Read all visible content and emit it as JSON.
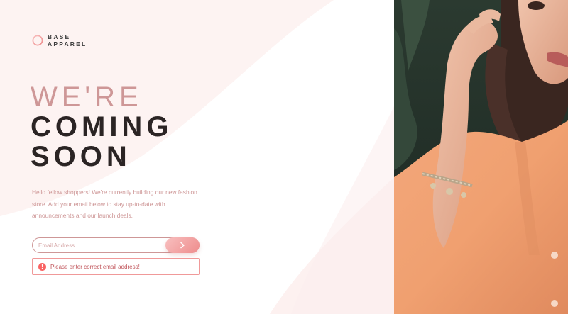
{
  "brand": {
    "line1": "BASE",
    "line2": "APPAREL",
    "icon": "ring-logo-icon"
  },
  "hero": {
    "headline_light": "WE'RE",
    "headline_dark_1": "COMING",
    "headline_dark_2": "SOON",
    "description": "Hello fellow shoppers! We're currently building our new fashion store. Add your email below to stay up-to-date with announcements and our launch deals."
  },
  "form": {
    "email_placeholder": "Email Address",
    "email_value": "",
    "submit_icon": "chevron-right-icon",
    "error_icon": "exclamation-circle-icon",
    "error_message": "Please enter correct email address!"
  },
  "colors": {
    "accent": "#ce9797",
    "dark_text": "#2b2424",
    "error": "#f96464",
    "button_gradient_start": "#f8bfbf",
    "button_gradient_end": "#ee8c8c",
    "background_tint": "#fdf1f0"
  },
  "photo": {
    "subject": "woman in orange shirt with bracelet"
  }
}
